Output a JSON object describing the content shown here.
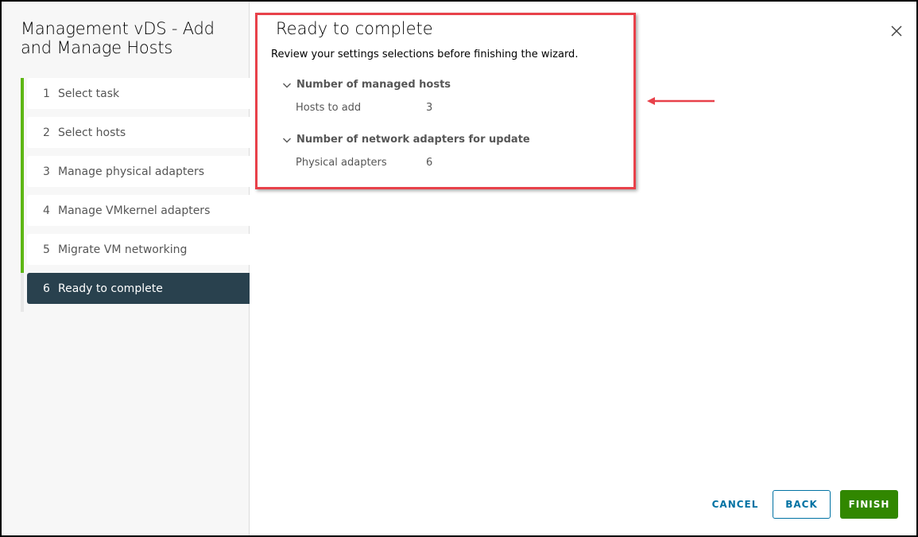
{
  "wizard": {
    "title": "Management vDS - Add and Manage Hosts",
    "steps": [
      {
        "num": "1",
        "label": "Select task",
        "state": "done"
      },
      {
        "num": "2",
        "label": "Select hosts",
        "state": "done"
      },
      {
        "num": "3",
        "label": "Manage physical adapters",
        "state": "done"
      },
      {
        "num": "4",
        "label": "Manage VMkernel adapters",
        "state": "done"
      },
      {
        "num": "5",
        "label": "Migrate VM networking",
        "state": "done"
      },
      {
        "num": "6",
        "label": "Ready to complete",
        "state": "active"
      }
    ]
  },
  "page": {
    "title": "Ready to complete",
    "description": "Review your settings selections before finishing the wizard.",
    "sections": [
      {
        "heading": "Number of managed hosts",
        "rows": [
          {
            "label": "Hosts to add",
            "value": "3"
          }
        ]
      },
      {
        "heading": "Number of network adapters for update",
        "rows": [
          {
            "label": "Physical adapters",
            "value": "6"
          }
        ]
      }
    ]
  },
  "footer": {
    "cancel_label": "CANCEL",
    "back_label": "BACK",
    "finish_label": "FINISH"
  },
  "icons": {
    "close": "close-icon",
    "chevron": "chevron-down-icon",
    "annotation_arrow": "arrow-left-icon"
  },
  "colors": {
    "active_step_bg": "#29414e",
    "completed_step_bar": "#5eb715",
    "primary_link": "#0072a3",
    "finish_bg": "#318700",
    "annotation_red": "#e8414a"
  }
}
